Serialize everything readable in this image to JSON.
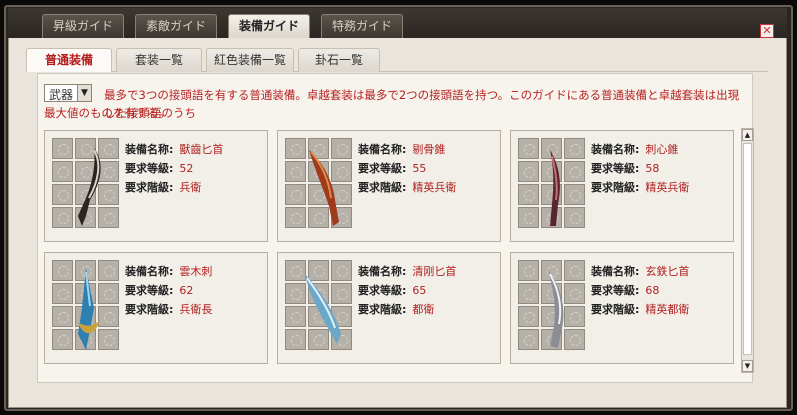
{
  "main_tabs": [
    {
      "label": "昇級ガイド"
    },
    {
      "label": "素敵ガイド"
    },
    {
      "label": "装備ガイド"
    },
    {
      "label": "特務ガイド"
    }
  ],
  "sub_tabs": [
    {
      "label": "普通装備"
    },
    {
      "label": "套装一覧"
    },
    {
      "label": "紅色装備一覧"
    },
    {
      "label": "卦石一覧"
    }
  ],
  "filter": {
    "selected": "武器"
  },
  "description_line1": "最多で3つの接頭語を有する普通装備。卓越套装は最多で2つの接頭語を持つ。このガイドにある普通装備と卓越套装は出現した接頭語のうち",
  "description_line2": "最大値のものを有する。",
  "labels": {
    "name": "装備名称:",
    "level": "要求等級:",
    "rank": "要求階級:"
  },
  "items": [
    {
      "name": "獸齒匕首",
      "level": "52",
      "rank": "兵衛"
    },
    {
      "name": "剔骨錐",
      "level": "55",
      "rank": "精英兵衛"
    },
    {
      "name": "刺心錐",
      "level": "58",
      "rank": "精英兵衛"
    },
    {
      "name": "雲木刺",
      "level": "62",
      "rank": "兵衛長"
    },
    {
      "name": "清刚匕首",
      "level": "65",
      "rank": "都衛"
    },
    {
      "name": "玄鉄匕首",
      "level": "68",
      "rank": "精英都衛"
    }
  ],
  "icons": {
    "close": "close-icon",
    "dropdown": "chevron-down-icon",
    "scroll_up": "arrow-up-icon",
    "scroll_down": "arrow-down-icon"
  }
}
